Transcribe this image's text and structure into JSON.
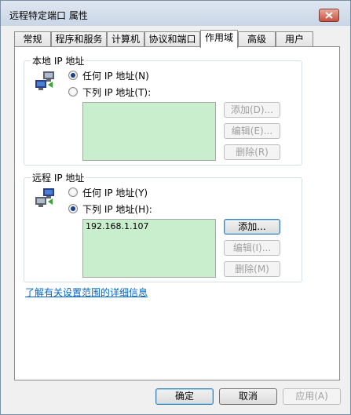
{
  "window": {
    "title": "远程特定端口 属性"
  },
  "tabs": [
    {
      "label": "常规"
    },
    {
      "label": "程序和服务"
    },
    {
      "label": "计算机"
    },
    {
      "label": "协议和端口"
    },
    {
      "label": "作用域"
    },
    {
      "label": "高级"
    },
    {
      "label": "用户"
    }
  ],
  "active_tab": "作用域",
  "local": {
    "title": "本地 IP 地址",
    "any_label": "任何 IP 地址(N)",
    "list_label": "下列 IP 地址(T):",
    "selected": "any",
    "addresses": [],
    "add_label": "添加(D)...",
    "edit_label": "编辑(E)...",
    "delete_label": "删除(R)"
  },
  "remote": {
    "title": "远程 IP 地址",
    "any_label": "任何 IP 地址(Y)",
    "list_label": "下列 IP 地址(H):",
    "selected": "list",
    "addresses": [
      "192.168.1.107"
    ],
    "add_label": "添加...",
    "edit_label": "编辑(I)...",
    "delete_label": "删除(M)"
  },
  "learn_more_link": "了解有关设置范围的详细信息",
  "footer": {
    "ok_label": "确定",
    "cancel_label": "取消",
    "apply_label": "应用(A)"
  },
  "colors": {
    "listbox_bg": "#c9eecd",
    "link": "#0066cc"
  }
}
